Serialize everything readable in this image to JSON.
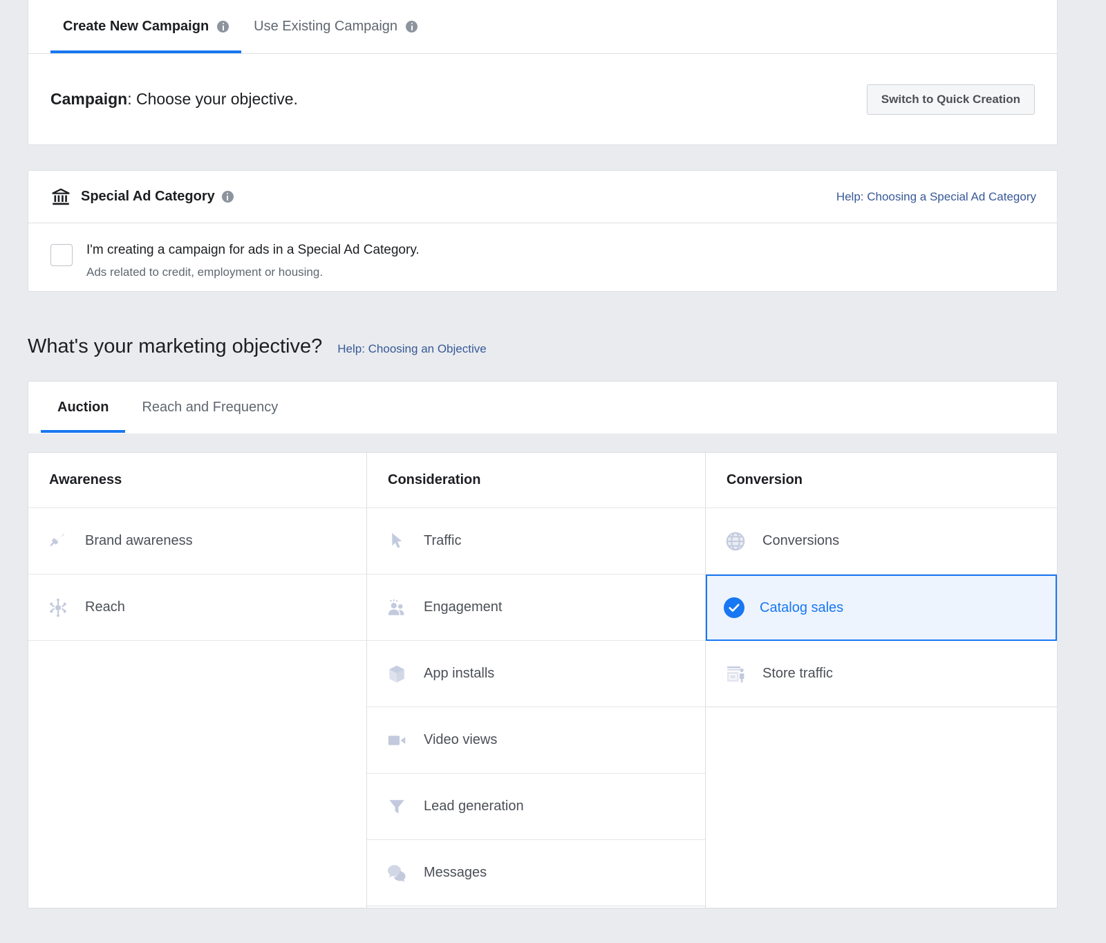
{
  "top_tabs": {
    "items": [
      {
        "label": "Create New Campaign",
        "active": true,
        "info": true
      },
      {
        "label": "Use Existing Campaign",
        "active": false,
        "info": true
      }
    ]
  },
  "campaign": {
    "label_bold": "Campaign",
    "label_rest": ": Choose your objective.",
    "switch_button": "Switch to Quick Creation"
  },
  "special_ad_category": {
    "icon": "bank-icon",
    "title": "Special Ad Category",
    "help_link": "Help: Choosing a Special Ad Category",
    "checkbox_checked": false,
    "checkbox_label": "I'm creating a campaign for ads in a Special Ad Category.",
    "checkbox_sublabel": "Ads related to credit, employment or housing."
  },
  "objective": {
    "heading": "What's your marketing objective?",
    "help_link": "Help: Choosing an Objective",
    "tabs": [
      {
        "label": "Auction",
        "active": true
      },
      {
        "label": "Reach and Frequency",
        "active": false
      }
    ]
  },
  "objective_table": {
    "columns": [
      {
        "header": "Awareness",
        "items": [
          {
            "label": "Brand awareness",
            "icon": "megaphone-icon",
            "selected": false
          },
          {
            "label": "Reach",
            "icon": "reach-icon",
            "selected": false
          }
        ]
      },
      {
        "header": "Consideration",
        "items": [
          {
            "label": "Traffic",
            "icon": "cursor-icon",
            "selected": false
          },
          {
            "label": "Engagement",
            "icon": "people-icon",
            "selected": false
          },
          {
            "label": "App installs",
            "icon": "cube-icon",
            "selected": false
          },
          {
            "label": "Video views",
            "icon": "video-camera-icon",
            "selected": false
          },
          {
            "label": "Lead generation",
            "icon": "funnel-icon",
            "selected": false
          },
          {
            "label": "Messages",
            "icon": "chat-bubbles-icon",
            "selected": false
          }
        ]
      },
      {
        "header": "Conversion",
        "items": [
          {
            "label": "Conversions",
            "icon": "globe-icon",
            "selected": false
          },
          {
            "label": "Catalog sales",
            "icon": "check-circle-icon",
            "selected": true
          },
          {
            "label": "Store traffic",
            "icon": "storefront-icon",
            "selected": false
          }
        ]
      }
    ]
  },
  "colors": {
    "accent": "#1877f2",
    "link": "#385898",
    "selected_bg": "#edf4fd",
    "page_bg": "#e9ebee",
    "icon_muted": "#c3cade"
  }
}
